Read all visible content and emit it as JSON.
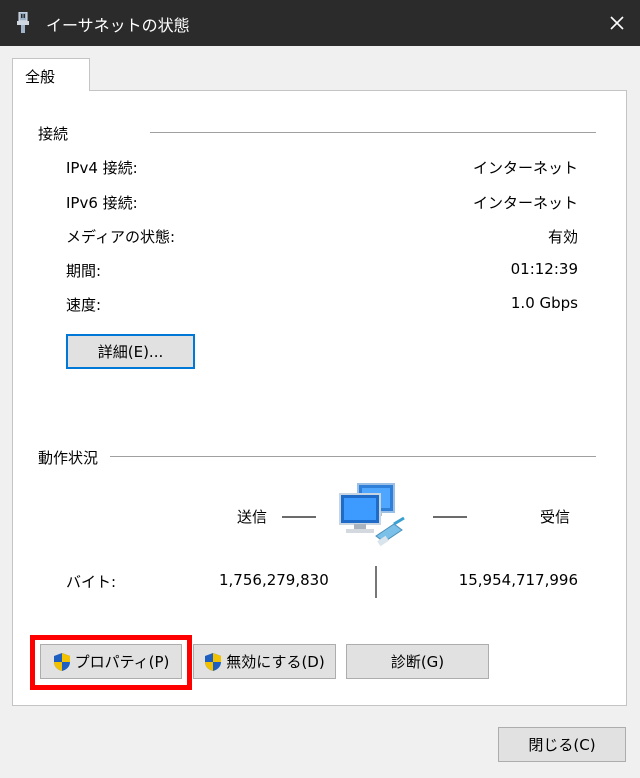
{
  "window": {
    "title": "イーサネットの状態"
  },
  "tabs": [
    {
      "label": "全般"
    }
  ],
  "connection": {
    "heading": "接続",
    "rows": [
      {
        "label": "IPv4 接続:",
        "value": "インターネット"
      },
      {
        "label": "IPv6 接続:",
        "value": "インターネット"
      },
      {
        "label": "メディアの状態:",
        "value": "有効"
      },
      {
        "label": "期間:",
        "value": "01:12:39"
      },
      {
        "label": "速度:",
        "value": "1.0 Gbps"
      }
    ],
    "details_button": "詳細(E)..."
  },
  "activity": {
    "heading": "動作状況",
    "sent_label": "送信",
    "received_label": "受信",
    "bytes_label": "バイト:",
    "bytes_sent": "1,756,279,830",
    "bytes_received": "15,954,717,996"
  },
  "buttons": {
    "properties": "プロパティ(P)",
    "disable": "無効にする(D)",
    "diagnose": "診断(G)",
    "close": "閉じる(C)"
  },
  "icons": {
    "app": "ethernet-adapter-icon",
    "close": "close-icon",
    "network": "network-computers-icon",
    "shield": "uac-shield-icon"
  },
  "colors": {
    "titlebar": "#2b2b2b",
    "focus_border": "#0078d7",
    "highlight": "#ff0000"
  }
}
